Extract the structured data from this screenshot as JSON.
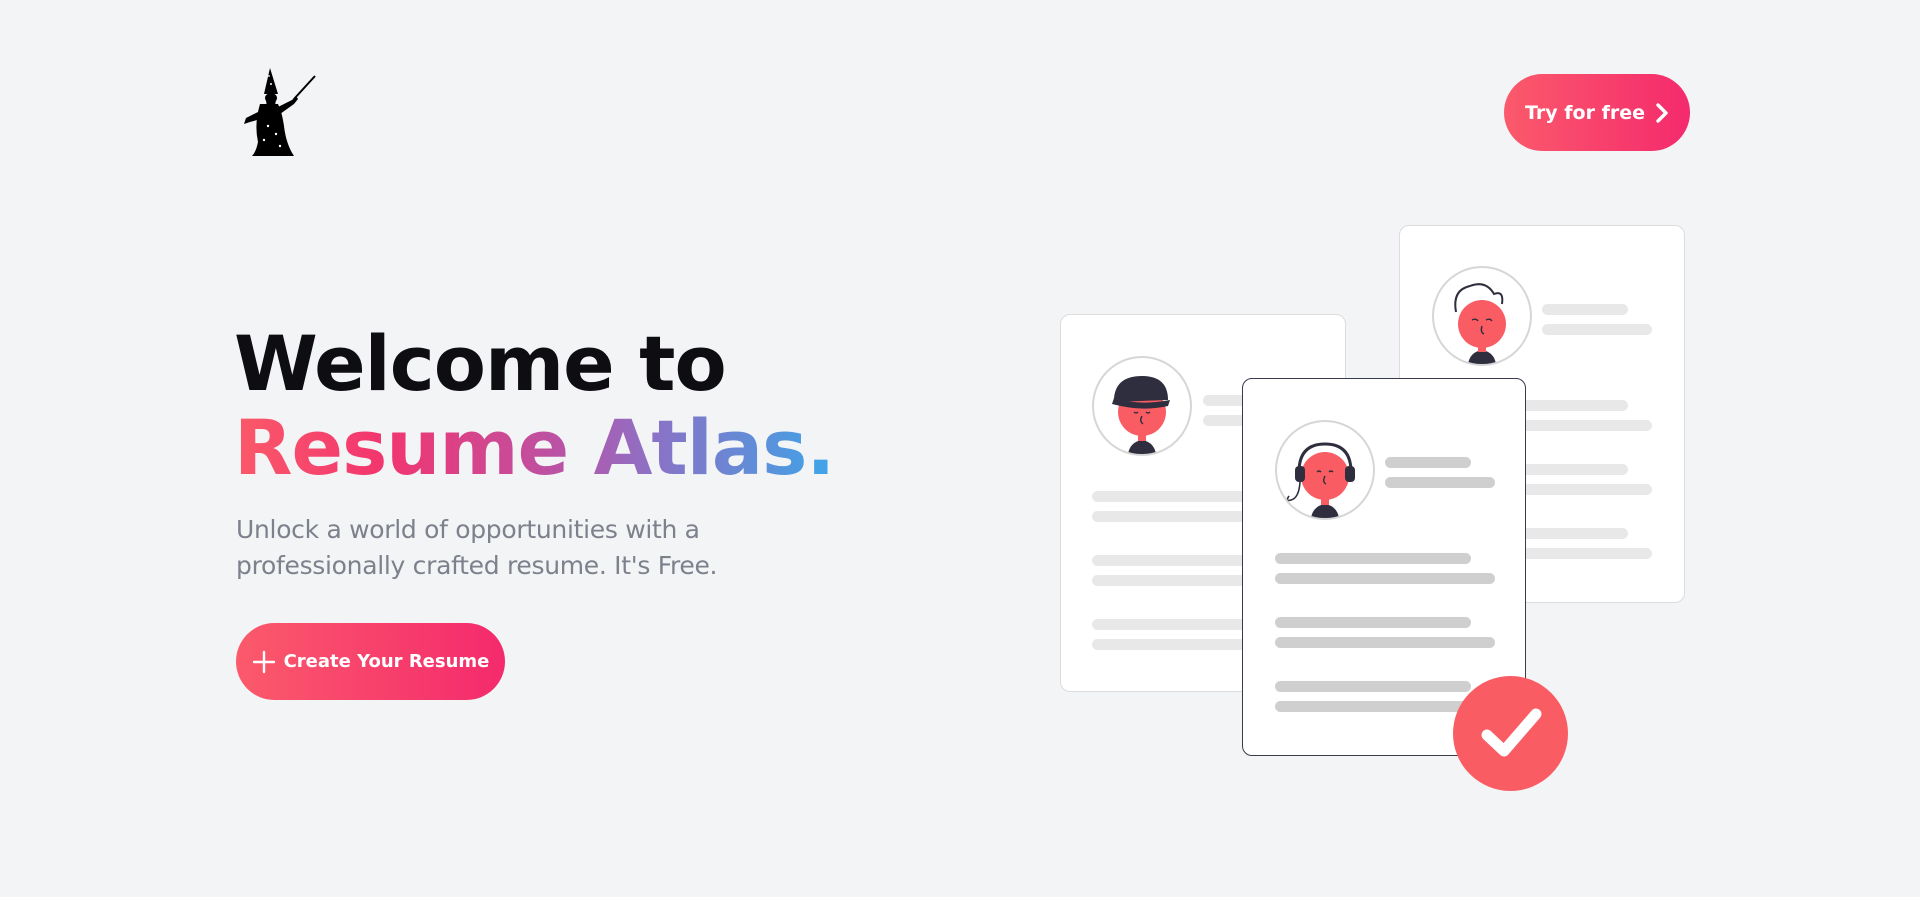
{
  "header": {
    "logo": {
      "alt": "wizard-logo",
      "color": "#000000"
    },
    "cta": {
      "label": "Try for free",
      "icon": "chevron-right-icon"
    }
  },
  "hero": {
    "title_line1": "Welcome to",
    "title_line2": "Resume Atlas.",
    "subtitle": "Unlock a world of opportunities with a professionally crafted resume. It's Free.",
    "primary_button": {
      "label": "Create Your Resume",
      "icon": "plus-icon"
    }
  },
  "illustration": {
    "cards": [
      {
        "name": "resume-card-left",
        "avatar": "cap-avatar-icon"
      },
      {
        "name": "resume-card-right",
        "avatar": "curly-hair-avatar-icon"
      },
      {
        "name": "resume-card-front",
        "avatar": "headset-avatar-icon"
      }
    ],
    "badge": "check-icon"
  },
  "colors": {
    "accent_start": "#fb5a6b",
    "accent_end": "#f42a6d",
    "coral": "#f95d63",
    "background": "#f3f4f6",
    "title": "#0d0d12",
    "subtitle": "#7d818c"
  }
}
